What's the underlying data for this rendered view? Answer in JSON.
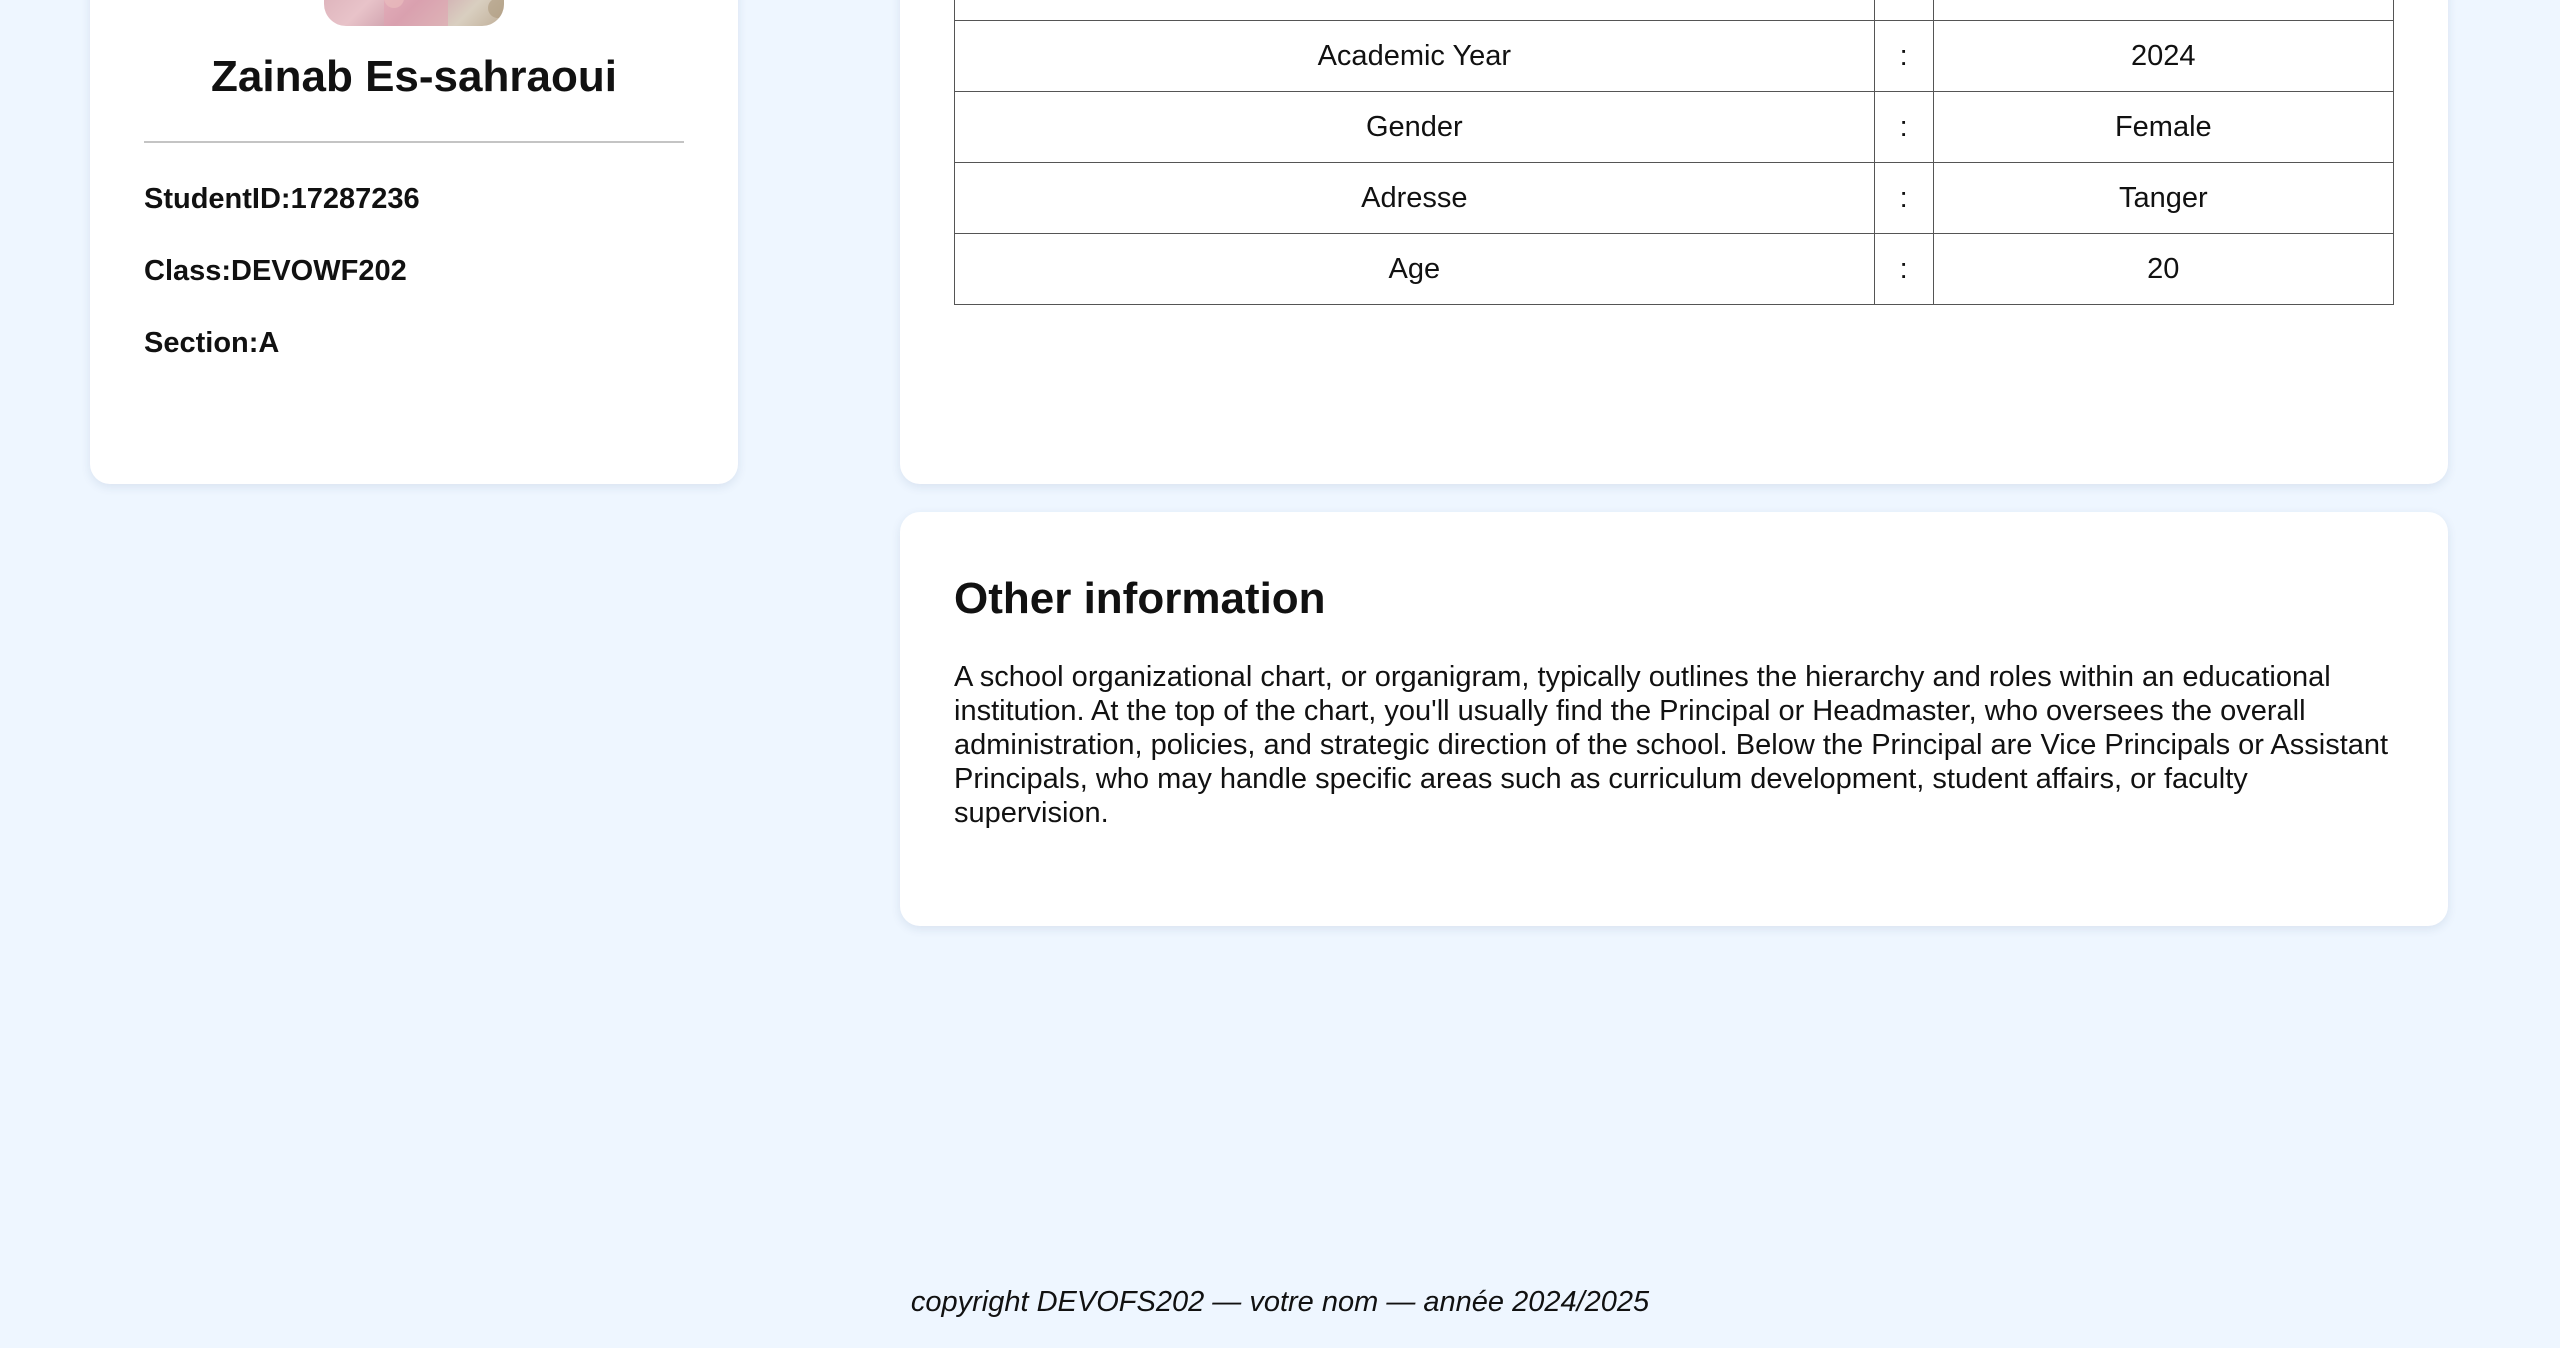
{
  "profile": {
    "avatar_icon": "student-photo",
    "name": "Zainab Es-sahraoui",
    "student_id": "StudentID:17287236",
    "class": "Class:DEVOWF202",
    "section": "Section:A"
  },
  "details": {
    "separator": ":",
    "rows": [
      {
        "label": "",
        "value": ""
      },
      {
        "label": "Academic Year",
        "value": "2024"
      },
      {
        "label": "Gender",
        "value": "Female"
      },
      {
        "label": "Adresse",
        "value": "Tanger"
      },
      {
        "label": "Age",
        "value": "20"
      }
    ]
  },
  "other": {
    "title": "Other information",
    "text": "A school organizational chart, or organigram, typically outlines the hierarchy and roles within an educational institution. At the top of the chart, you'll usually find the Principal or Headmaster, who oversees the overall administration, policies, and strategic direction of the school. Below the Principal are Vice Principals or Assistant Principals, who may handle specific areas such as curriculum development, student affairs, or faculty supervision."
  },
  "footer": {
    "text": "copyright DEVOFS202 — votre nom — année 2024/2025"
  },
  "colors": {
    "background": "#eef6ff",
    "card": "#ffffff",
    "text": "#111111",
    "table_border": "#555555"
  }
}
